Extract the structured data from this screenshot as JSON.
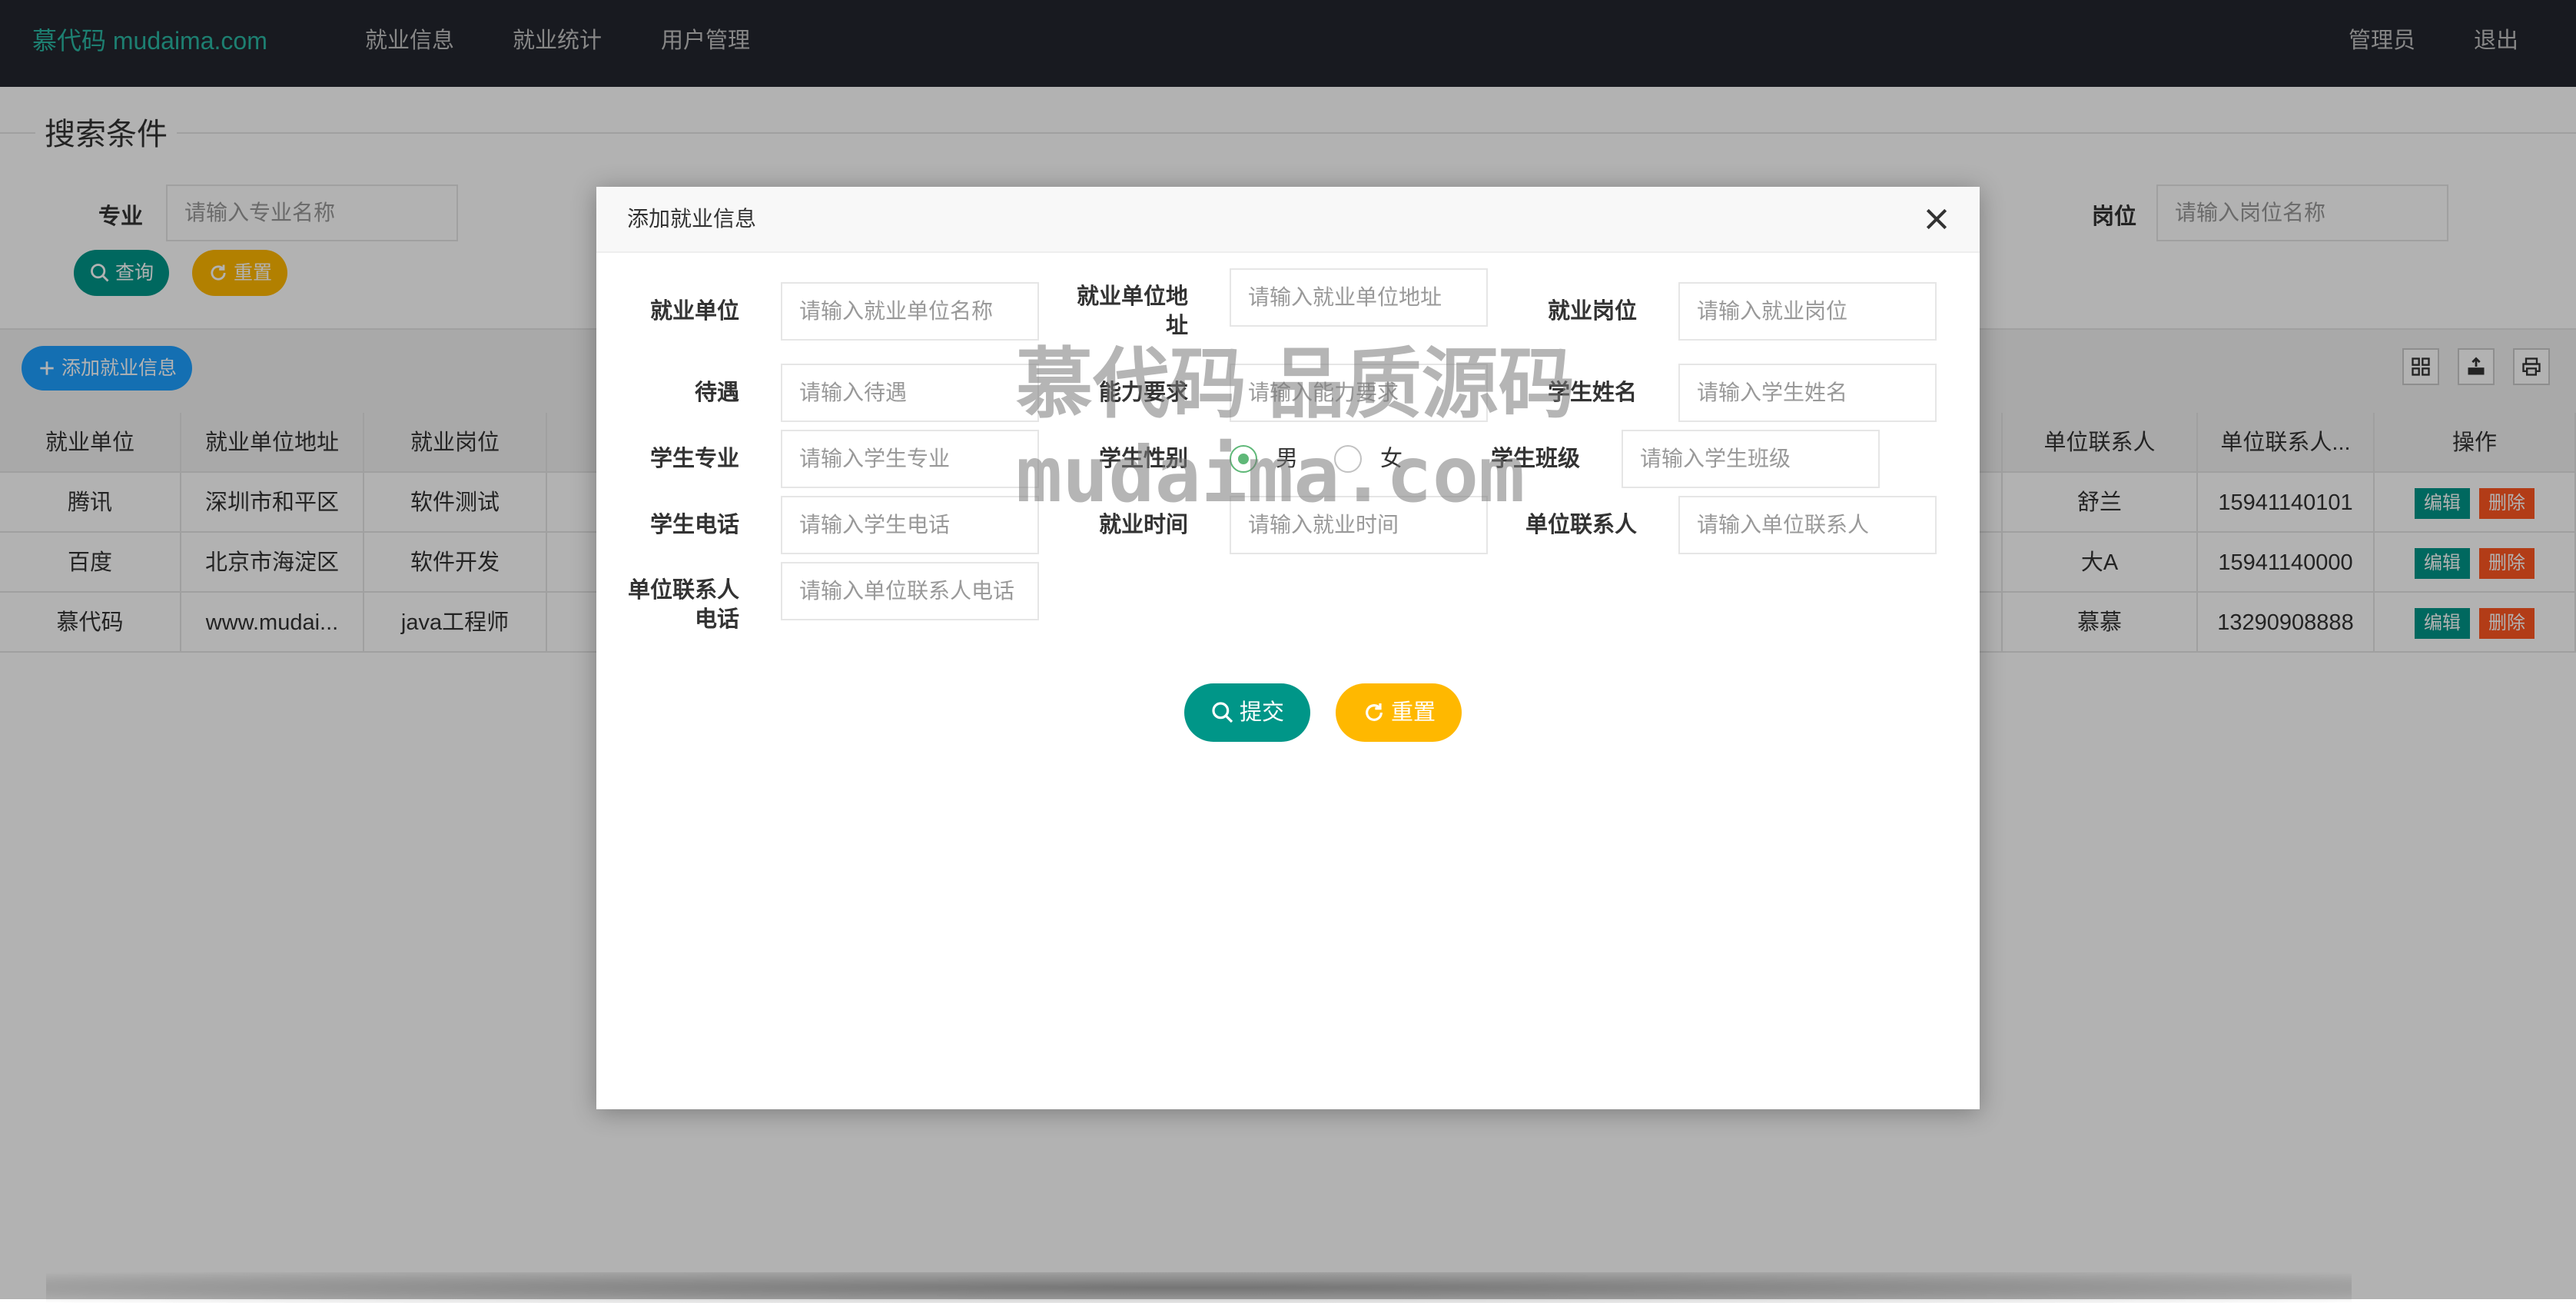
{
  "navbar": {
    "brand": "慕代码 mudaima.com",
    "menu": [
      "就业信息",
      "就业统计",
      "用户管理"
    ],
    "user": "管理员",
    "logout": "退出"
  },
  "search": {
    "legend": "搜索条件",
    "major_label": "专业",
    "major_placeholder": "请输入专业名称",
    "position_label": "岗位",
    "position_placeholder": "请输入岗位名称",
    "query_btn": "查询",
    "reset_btn": "重置"
  },
  "toolbar": {
    "add_btn": "添加就业信息"
  },
  "table": {
    "headers_left": [
      "就业单位",
      "就业单位地址",
      "就业岗位"
    ],
    "headers_right": [
      "单位联系人",
      "单位联系人...",
      "操作"
    ],
    "rows": [
      {
        "unit": "腾讯",
        "address": "深圳市和平区",
        "job": "软件测试",
        "contact": "舒兰",
        "phone": "15941140101"
      },
      {
        "unit": "百度",
        "address": "北京市海淀区",
        "job": "软件开发",
        "contact": "大A",
        "phone": "15941140000"
      },
      {
        "unit": "慕代码",
        "address": "www.mudai...",
        "job": "java工程师",
        "contact": "慕慕",
        "phone": "13290908888"
      }
    ],
    "edit": "编辑",
    "delete": "删除"
  },
  "modal": {
    "title": "添加就业信息",
    "fields": {
      "unit_label": "就业单位",
      "unit_ph": "请输入就业单位名称",
      "address_label_1": "就业单位地",
      "address_label_2": "址",
      "address_ph": "请输入就业单位地址",
      "job_label": "就业岗位",
      "job_ph": "请输入就业岗位",
      "salary_label": "待遇",
      "salary_ph": "请输入待遇",
      "ability_label": "能力要求",
      "ability_ph": "请输入能力要求",
      "name_label": "学生姓名",
      "name_ph": "请输入学生姓名",
      "major_label": "学生专业",
      "major_ph": "请输入学生专业",
      "gender_label": "学生性别",
      "male": "男",
      "female": "女",
      "class_label": "学生班级",
      "class_ph": "请输入学生班级",
      "phone_label": "学生电话",
      "phone_ph": "请输入学生电话",
      "time_label": "就业时间",
      "time_ph": "请输入就业时间",
      "contact_label": "单位联系人",
      "contact_ph": "请输入单位联系人",
      "cphone_label_1": "单位联系人",
      "cphone_label_2": "电话",
      "cphone_ph": "请输入单位联系人电话"
    },
    "submit_btn": "提交",
    "reset_btn": "重置"
  },
  "watermark": {
    "line1": "慕代码 品质源码",
    "line2": "mudaima.com"
  }
}
